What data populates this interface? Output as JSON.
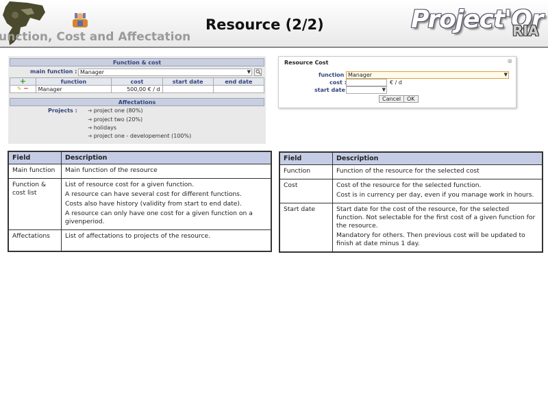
{
  "header": {
    "title": "Resource (2/2)",
    "subtitle": "unction, Cost and Affectation",
    "brand": "Project'Or",
    "brand_suffix": "RIA"
  },
  "left_panel": {
    "function_cost_header": "Function & cost",
    "main_function_label": "main function :",
    "main_function_value": "Manager",
    "columns": [
      "function",
      "cost",
      "start date",
      "end date"
    ],
    "rows": [
      {
        "function": "Manager",
        "cost": "500,00 € / d",
        "start_date": "",
        "end_date": ""
      }
    ],
    "affectations_header": "Affectations",
    "projects_label": "Projects :",
    "projects": [
      "project one (80%)",
      "project two (20%)",
      "holidays",
      "project one - developement (100%)"
    ]
  },
  "dialog": {
    "title": "Resource Cost",
    "function_label": "function :",
    "function_value": "Manager",
    "cost_label": "cost :",
    "cost_unit": "€ / d",
    "start_date_label": "start date :",
    "cancel_label": "Cancel",
    "ok_label": "OK"
  },
  "doc_left": {
    "headers": [
      "Field",
      "Description"
    ],
    "rows": [
      {
        "field": "Main function",
        "desc": [
          "Main function of the resource"
        ]
      },
      {
        "field": "Function & cost list",
        "desc": [
          "List of resource cost for a given function.",
          "A resource can have several cost for different functions.",
          "Costs also have history (validity from start to end date).",
          "A resource can only have one cost for a given function on a givenperiod."
        ]
      },
      {
        "field": "Affectations",
        "desc": [
          "List of affectations to projects of the resource."
        ]
      }
    ]
  },
  "doc_right": {
    "headers": [
      "Field",
      "Description"
    ],
    "rows": [
      {
        "field": "Function",
        "desc": [
          "Function of the resource for the selected cost"
        ]
      },
      {
        "field": "Cost",
        "desc": [
          "Cost of the resource for the selected function.",
          "Cost is in currency per day, even if you manage work in hours."
        ]
      },
      {
        "field": "Start date",
        "desc": [
          "Start date for the cost of the resource, for the selected function. Not selectable for the first cost of a given function for the resource.",
          "Mandatory for others. Then previous cost will be updated to finish at date minus 1 day."
        ]
      }
    ]
  },
  "colors": {
    "header_blue": "#c5cde6",
    "label_blue": "#33447a",
    "add_green": "#3a9a2a",
    "remove_red": "#cc2222"
  }
}
